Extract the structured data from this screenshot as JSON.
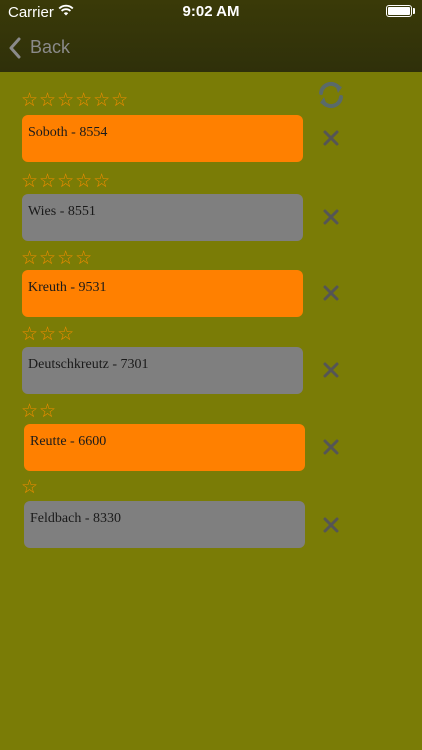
{
  "status_bar": {
    "carrier": "Carrier",
    "time": "9:02 AM"
  },
  "nav": {
    "back_label": "Back"
  },
  "colors": {
    "background": "#7a7c06",
    "nav": "#353509",
    "star": "#f28c00",
    "item_orange": "#ff8000",
    "item_gray": "#7f7f7f",
    "delete": "#555555",
    "refresh": "#5a6a6a"
  },
  "icons": {
    "refresh": "refresh-icon",
    "delete": "close-icon",
    "star": "star-outline-icon",
    "back": "chevron-left-icon"
  },
  "items": [
    {
      "stars": "☆☆☆☆☆☆",
      "label": "Soboth - 8554",
      "color": "orange"
    },
    {
      "stars": "☆☆☆☆☆",
      "label": "Wies - 8551",
      "color": "gray"
    },
    {
      "stars": "☆☆☆☆",
      "label": "Kreuth - 9531",
      "color": "orange"
    },
    {
      "stars": "☆☆☆",
      "label": "Deutschkreutz - 7301",
      "color": "gray"
    },
    {
      "stars": "☆☆",
      "label": "Reutte - 6600",
      "color": "orange"
    },
    {
      "stars": "☆",
      "label": "Feldbach - 8330",
      "color": "gray"
    }
  ]
}
